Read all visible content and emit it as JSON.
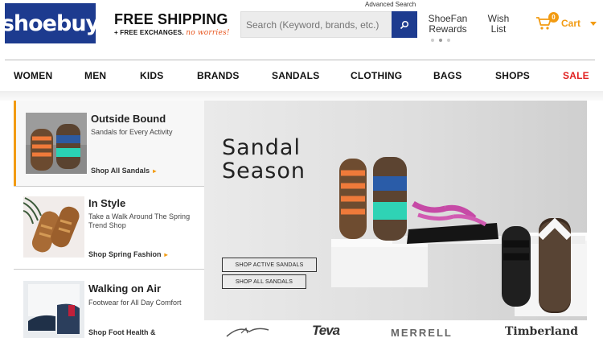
{
  "header": {
    "logo": "shoebuy",
    "shipping_title": "FREE SHIPPING",
    "shipping_sub": "+ FREE EXCHANGES.",
    "shipping_worry": "no worries!",
    "advanced_search": "Advanced Search",
    "search_placeholder": "Search (Keyword, brands, etc.)",
    "rewards": "ShoeFan Rewards",
    "wish": "Wish List",
    "cart_count": "0",
    "cart_label": "Cart"
  },
  "nav": [
    "WOMEN",
    "MEN",
    "KIDS",
    "BRANDS",
    "SANDALS",
    "CLOTHING",
    "BAGS",
    "SHOPS",
    "SALE"
  ],
  "promos": [
    {
      "title": "Outside Bound",
      "desc": "Sandals for Every Activity",
      "link": "Shop All Sandals"
    },
    {
      "title": "In Style",
      "desc": "Take a Walk Around The Spring Trend Shop",
      "link": "Shop Spring Fashion"
    },
    {
      "title": "Walking on Air",
      "desc": "Footwear for All Day Comfort",
      "link": "Shop Foot Health &"
    }
  ],
  "hero": {
    "title_line1": "Sandal",
    "title_line2": "Season",
    "btn_active": "SHOP ACTIVE SANDALS",
    "btn_all": "SHOP ALL SANDALS"
  },
  "brands": [
    "Teva",
    "MERRELL",
    "Timberland"
  ],
  "colors": {
    "brand_blue": "#1d3b8f",
    "accent_orange": "#f29b12",
    "sale_red": "#e02020"
  }
}
